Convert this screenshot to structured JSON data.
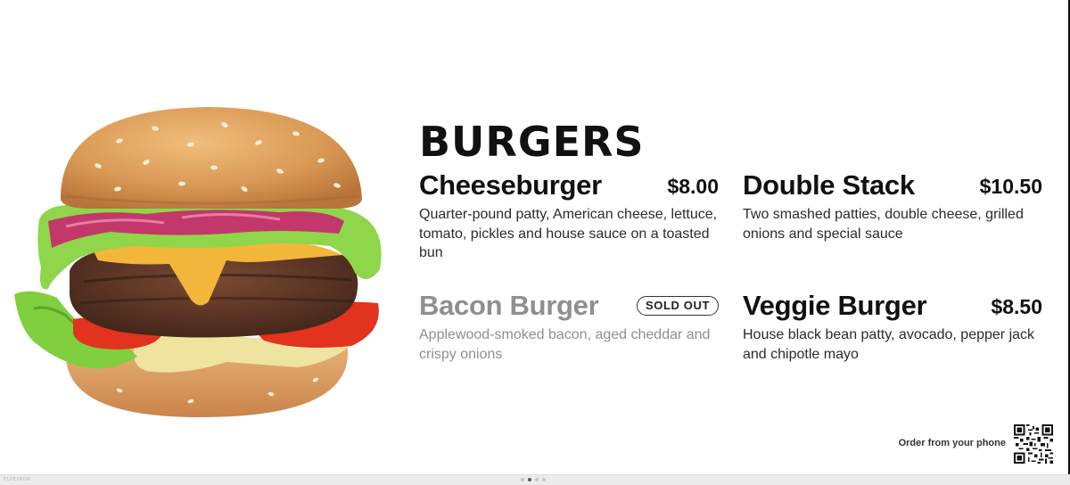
{
  "menu": {
    "category": "BURGERS",
    "items": [
      {
        "name": "Cheeseburger",
        "price": "$8.00",
        "description": "Quarter-pound patty, American cheese, lettuce, tomato, pickles and house sauce on a toasted bun"
      },
      {
        "name": "Double Stack",
        "price": "$10.50",
        "description": "Two smashed patties, double cheese, grilled onions and special sauce"
      },
      {
        "name": "Bacon Burger",
        "badge": "SOLD OUT",
        "status": "sold-out",
        "description": "Applewood-smoked bacon, aged cheddar and crispy onions"
      },
      {
        "name": "Veggie Burger",
        "price": "$8.50",
        "description": "House black bean patty, avocado, pepper jack and chipotle mayo"
      }
    ]
  },
  "order": {
    "label": "Order from your phone",
    "icon": "qr-code-icon"
  },
  "footer": {
    "mark": "ELPEXBOK"
  },
  "pager": {
    "page_count": 4,
    "active_page": 2
  },
  "colors": {
    "background": "#ffffff",
    "text": "#111111",
    "sold_out_text": "#8f8f8f",
    "bun": "#d99a55",
    "patty": "#5a3322",
    "cheese": "#f2b63a",
    "lettuce": "#7fcf3e",
    "tomato": "#e2331f",
    "onion": "#c2386b"
  }
}
